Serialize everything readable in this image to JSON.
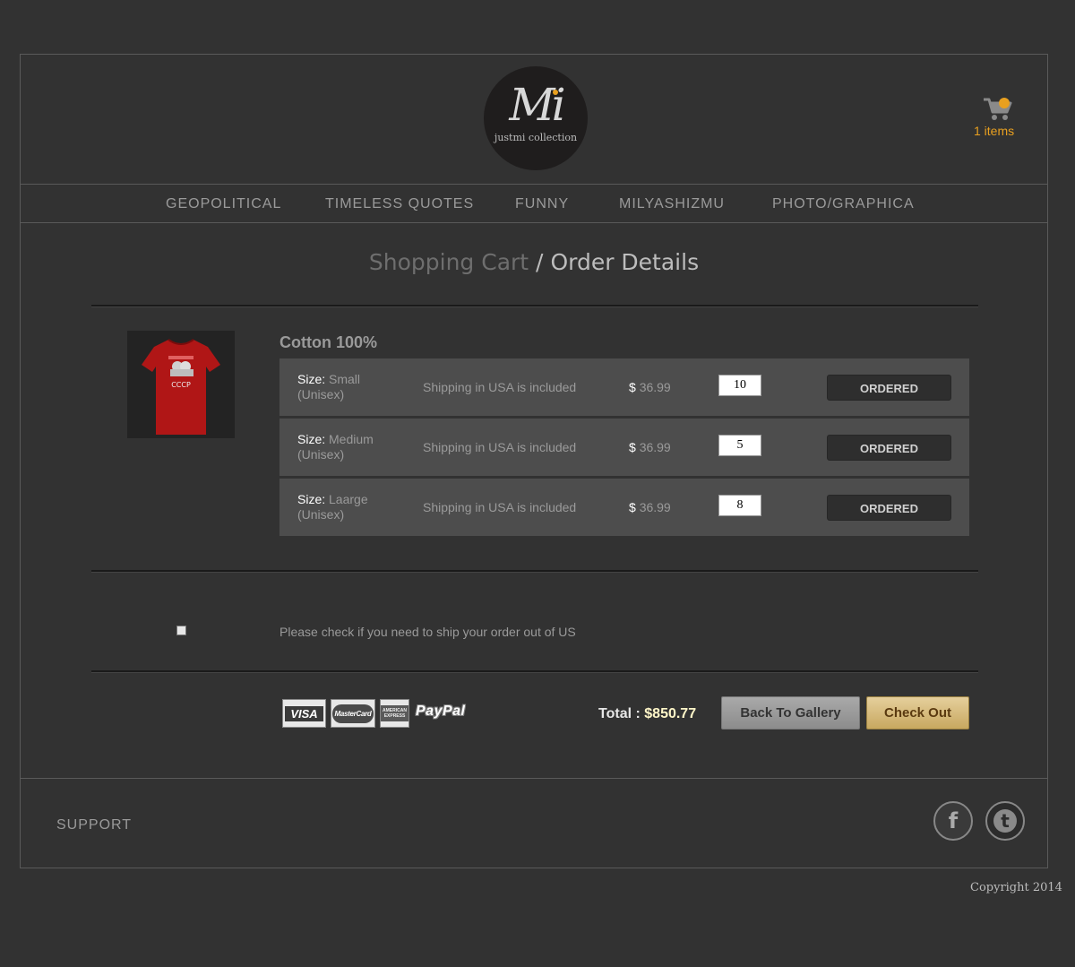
{
  "logo": {
    "mark": "Mi",
    "subtitle": "justmi collection"
  },
  "cart": {
    "icon": "shopping-cart-icon",
    "count_label": "1 items",
    "accent": "#e8a020"
  },
  "nav": {
    "items": [
      {
        "label": "GEOPOLITICAL"
      },
      {
        "label": "TIMELESS QUOTES"
      },
      {
        "label": "FUNNY"
      },
      {
        "label": "MILYASHIZMU"
      },
      {
        "label": "PHOTO/GRAPHICA"
      }
    ]
  },
  "heading": {
    "part1": "Shopping Cart",
    "separator": " / ",
    "part2": "Order Details"
  },
  "product": {
    "title": "Cotton 100%",
    "thumbnail_text": "CCCP",
    "rows": [
      {
        "size_label": "Size:",
        "size": "Small",
        "unisex": "(Unisex)",
        "shipping": "Shipping in USA is included",
        "currency": "$",
        "price": "36.99",
        "quantity": "10",
        "status": "ORDERED"
      },
      {
        "size_label": "Size:",
        "size": "Medium",
        "unisex": "(Unisex)",
        "shipping": "Shipping in USA is included",
        "currency": "$",
        "price": "36.99",
        "quantity": "5",
        "status": "ORDERED"
      },
      {
        "size_label": "Size:",
        "size": "Laarge",
        "unisex": "(Unisex)",
        "shipping": "Shipping in USA is included",
        "currency": "$",
        "price": "36.99",
        "quantity": "8",
        "status": "ORDERED"
      }
    ]
  },
  "shipping_option": {
    "label": "Please check if you need to ship your order out of US",
    "checked": false
  },
  "payment": {
    "visa": "VISA",
    "mastercard": "MasterCard",
    "amex": "AMERICAN EXPRESS",
    "paypal": "PayPal"
  },
  "total": {
    "label": "Total :",
    "amount": "$850.77"
  },
  "buttons": {
    "back": "Back To Gallery",
    "checkout": "Check Out"
  },
  "footer": {
    "support": "SUPPORT",
    "facebook_icon": "facebook-icon",
    "twitter_icon": "twitter-icon",
    "facebook_glyph": "f",
    "twitter_glyph": "t",
    "copyright": "Copyright 2014"
  }
}
